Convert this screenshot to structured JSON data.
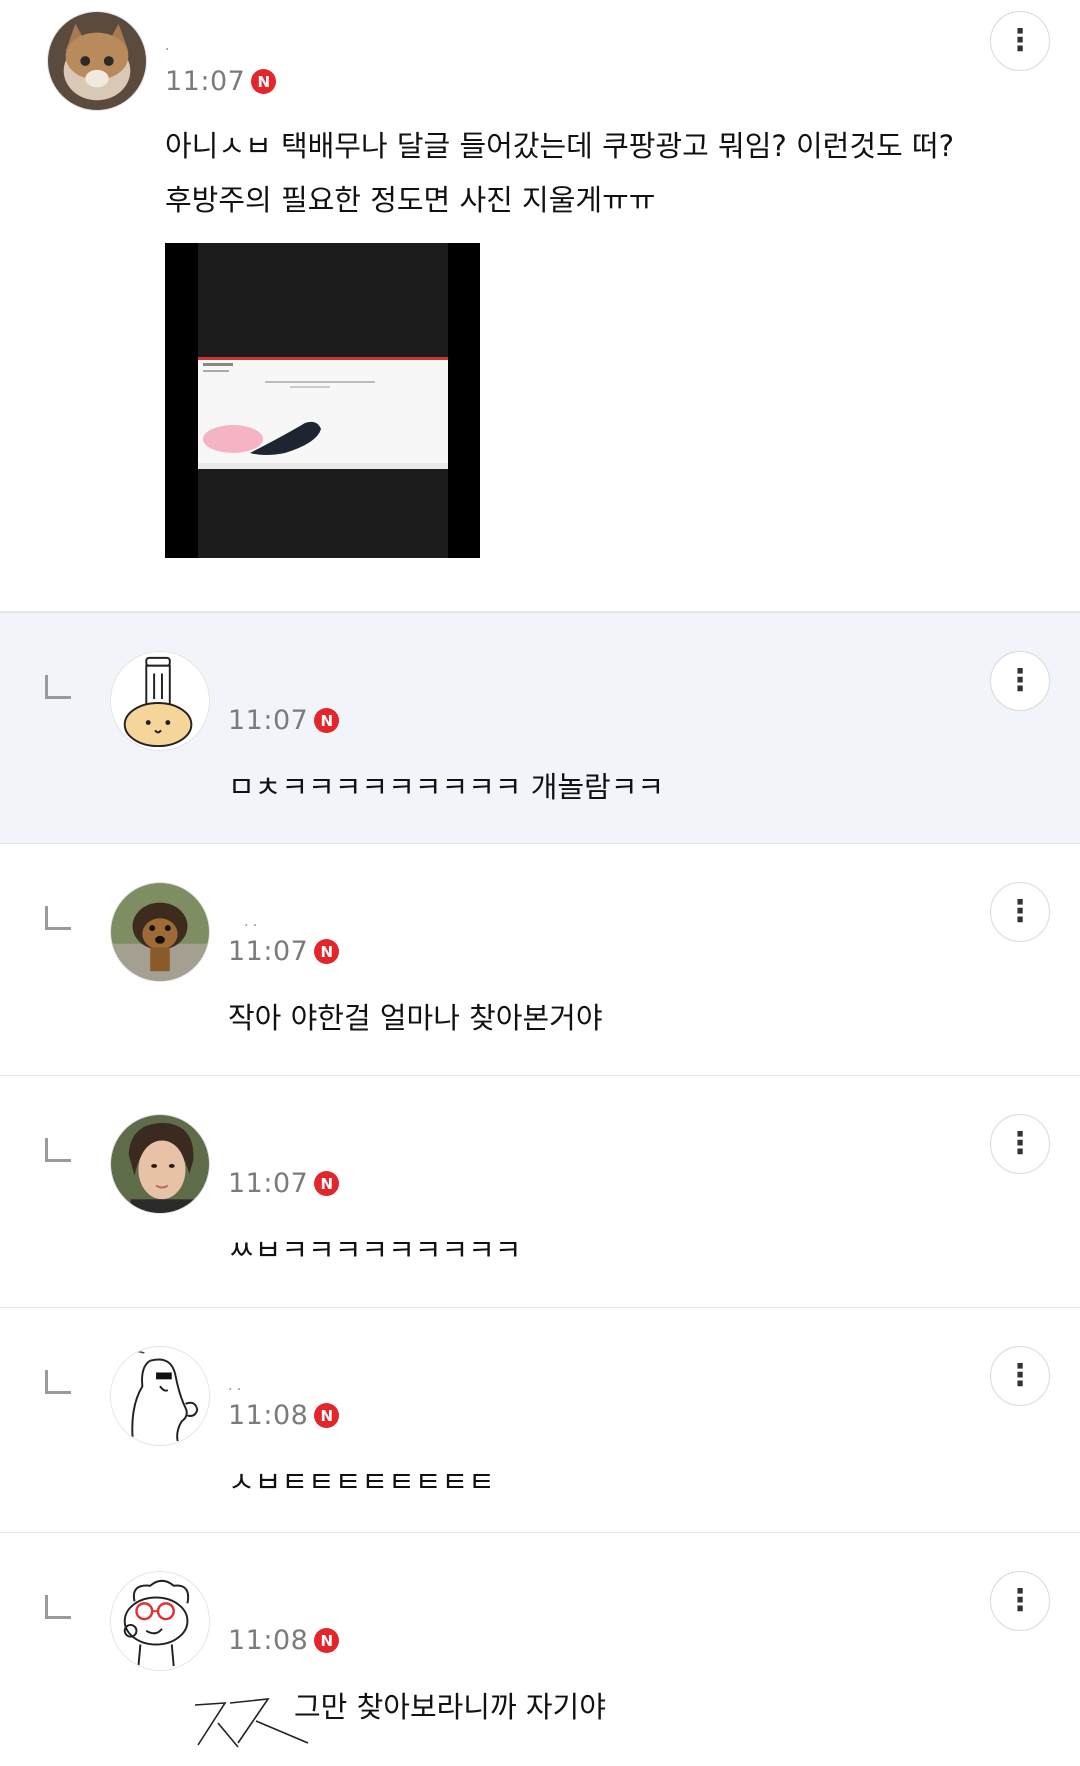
{
  "comments": [
    {
      "nickname": ".",
      "time": "11:07",
      "badge": "N",
      "text_lines": [
        "아니ㅅㅂ 택배무나 달글 들어갔는데 쿠팡광고 뭐임? 이런것도 떠?",
        "후방주의 필요한 정도면 사진 지울게ㅠㅠ"
      ],
      "has_image": true
    },
    {
      "nickname": "",
      "time": "11:07",
      "badge": "N",
      "text": "ㅁㅊㅋㅋㅋㅋㅋㅋㅋㅋㅋ 개놀람ㅋㅋ",
      "is_reply": true
    },
    {
      "nickname": ". .",
      "time": "11:07",
      "badge": "N",
      "text": "작아 야한걸 얼마나 찾아본거야",
      "is_reply": true
    },
    {
      "nickname": "",
      "time": "11:07",
      "badge": "N",
      "text": "ㅆㅂㅋㅋㅋㅋㅋㅋㅋㅋㅋ",
      "is_reply": true
    },
    {
      "nickname": ". .",
      "time": "11:08",
      "badge": "N",
      "text": "ㅅㅂㅌㅌㅌㅌㅌㅌㅌㅌ",
      "is_reply": true
    },
    {
      "nickname": "",
      "time": "11:08",
      "badge": "N",
      "text": "그만 찾아보라니까 자기야",
      "is_reply": true
    }
  ],
  "icons": {
    "more": "more-vertical-icon",
    "reply": "reply-arrow-icon",
    "badge": "new-badge-icon"
  },
  "colors": {
    "badge_red": "#e3262b",
    "highlight_bg": "#f1f5fa",
    "time_gray": "#7b7b7b"
  },
  "more_glyph": "⋮"
}
